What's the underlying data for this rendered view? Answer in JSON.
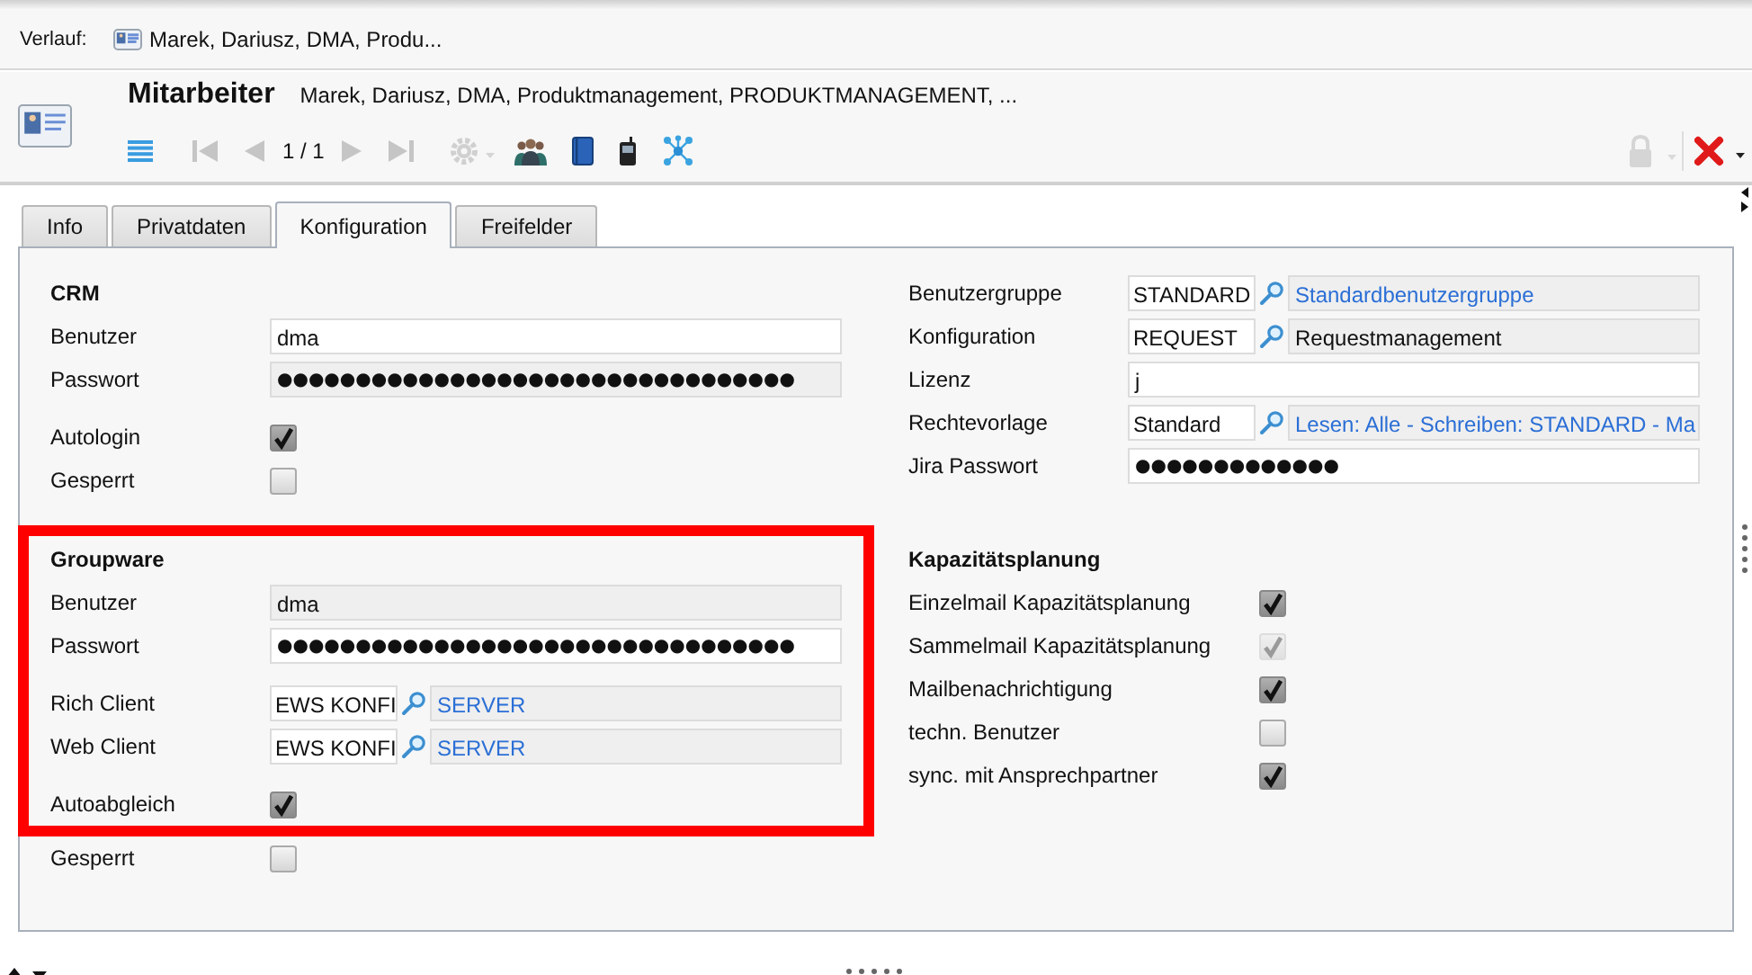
{
  "history": {
    "label": "Verlauf:",
    "items": [
      {
        "text": "Marek, Dariusz, DMA, Produ..."
      }
    ]
  },
  "record": {
    "title": "Mitarbeiter",
    "subtitle": "Marek, Dariusz, DMA, Produktmanagement, PRODUKTMANAGEMENT, ..."
  },
  "toolbar": {
    "items": [
      {
        "kind": "list",
        "disabled": false
      },
      {
        "kind": "first",
        "disabled": true
      },
      {
        "kind": "prev",
        "disabled": true
      },
      {
        "kind": "counter",
        "text": "1 / 1"
      },
      {
        "kind": "next",
        "disabled": true
      },
      {
        "kind": "last",
        "disabled": true
      },
      {
        "kind": "gear",
        "disabled": true
      },
      {
        "kind": "people",
        "disabled": false
      },
      {
        "kind": "book",
        "disabled": false
      },
      {
        "kind": "phone",
        "disabled": false
      },
      {
        "kind": "network",
        "disabled": false
      }
    ],
    "actions": [
      {
        "kind": "lock",
        "disabled": true
      },
      {
        "kind": "close",
        "disabled": false
      }
    ]
  },
  "tabs": [
    {
      "label": "Info",
      "selected": false
    },
    {
      "label": "Privatdaten",
      "selected": false
    },
    {
      "label": "Konfiguration",
      "selected": true
    },
    {
      "label": "Freifelder",
      "selected": false
    }
  ],
  "panel": {
    "columns": [
      {
        "sections": [
          {
            "heading": "CRM",
            "highlighted": false,
            "groups": [
              {
                "rows": [
                  {
                    "kind": "text",
                    "label": "Benutzer",
                    "value": "dma",
                    "editable": true
                  },
                  {
                    "kind": "text",
                    "label": "Passwort",
                    "value": "●●●●●●●●●●●●●●●●●●●●●●●●●●●●●●●●●",
                    "editable": false
                  }
                ]
              },
              {
                "rows": [
                  {
                    "kind": "checkbox",
                    "label": "Autologin",
                    "checked": true,
                    "disabled": false
                  },
                  {
                    "kind": "checkbox",
                    "label": "Gesperrt",
                    "checked": false,
                    "disabled": false
                  }
                ]
              }
            ]
          },
          {
            "heading": "Groupware",
            "highlighted": true,
            "groups": [
              {
                "rows": [
                  {
                    "kind": "text",
                    "label": "Benutzer",
                    "value": "dma",
                    "editable": false
                  },
                  {
                    "kind": "text",
                    "label": "Passwort",
                    "value": "●●●●●●●●●●●●●●●●●●●●●●●●●●●●●●●●●",
                    "editable": true
                  }
                ]
              },
              {
                "rows": [
                  {
                    "kind": "lookup",
                    "label": "Rich Client",
                    "code": "EWS KONFI",
                    "description": "SERVER",
                    "link": true
                  },
                  {
                    "kind": "lookup",
                    "label": "Web Client",
                    "code": "EWS KONFI",
                    "description": "SERVER",
                    "link": true
                  }
                ]
              },
              {
                "rows": [
                  {
                    "kind": "checkbox",
                    "label": "Autoabgleich",
                    "checked": true,
                    "disabled": false
                  }
                ]
              }
            ]
          },
          {
            "highlighted": false,
            "groups": [
              {
                "rows": [
                  {
                    "kind": "checkbox",
                    "label": "Gesperrt",
                    "checked": false,
                    "disabled": false
                  }
                ]
              }
            ]
          }
        ]
      },
      {
        "sections": [
          {
            "highlighted": false,
            "groups": [
              {
                "rows": [
                  {
                    "kind": "lookup",
                    "label": "Benutzergruppe",
                    "code": "STANDARD",
                    "description": "Standardbenutzergruppe",
                    "link": true
                  },
                  {
                    "kind": "lookup",
                    "label": "Konfiguration",
                    "code": "REQUEST",
                    "description": "Requestmanagement",
                    "link": false
                  },
                  {
                    "kind": "text",
                    "label": "Lizenz",
                    "value": "j",
                    "editable": true
                  },
                  {
                    "kind": "lookup",
                    "label": "Rechtevorlage",
                    "code": "Standard",
                    "description": "Lesen: Alle - Schreiben: STANDARD - Ma",
                    "link": true
                  },
                  {
                    "kind": "text",
                    "label": "Jira Passwort",
                    "value": "●●●●●●●●●●●●●",
                    "editable": true
                  }
                ]
              }
            ]
          },
          {
            "heading": "Kapazitätsplanung",
            "highlighted": false,
            "groups": [
              {
                "rows": [
                  {
                    "kind": "checkbox",
                    "label": "Einzelmail Kapazitätsplanung",
                    "checked": true,
                    "disabled": false
                  },
                  {
                    "kind": "checkbox",
                    "label": "Sammelmail Kapazitätsplanung",
                    "checked": true,
                    "disabled": true
                  },
                  {
                    "kind": "checkbox",
                    "label": "Mailbenachrichtigung",
                    "checked": true,
                    "disabled": false
                  },
                  {
                    "kind": "checkbox",
                    "label": "techn. Benutzer",
                    "checked": false,
                    "disabled": false
                  },
                  {
                    "kind": "checkbox",
                    "label": "sync. mit Ansprechpartner",
                    "checked": true,
                    "disabled": false
                  }
                ]
              }
            ]
          }
        ]
      }
    ]
  }
}
